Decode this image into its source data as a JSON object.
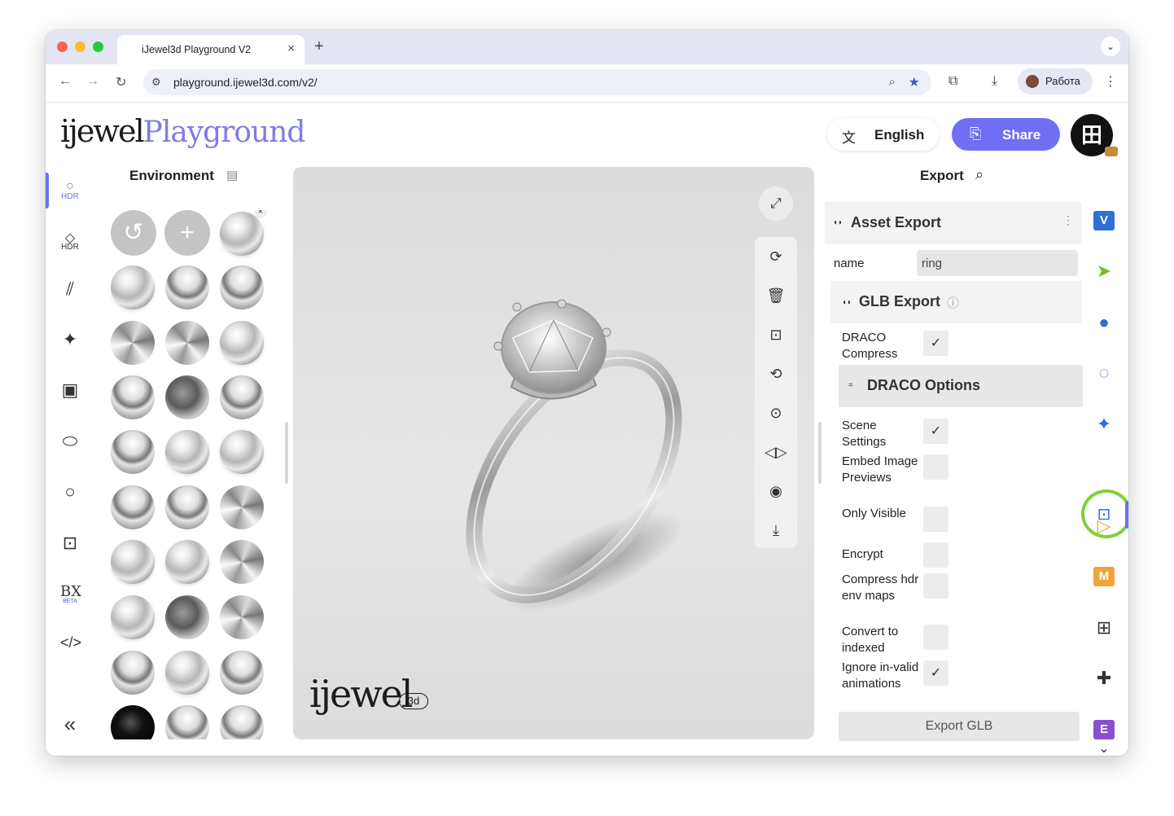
{
  "browser": {
    "tab_title": "iJewel3d Playground V2",
    "tab_close": "×",
    "new_tab": "+",
    "url": "playground.ijewel3d.com/v2/",
    "profile_name": "Работа"
  },
  "header": {
    "logo_brand": "ijewel",
    "logo_product": "Playground",
    "language_label": "English",
    "share_label": "Share"
  },
  "left_rail": {
    "items": [
      {
        "icon": "hdr-environment-icon",
        "sub": "HDR"
      },
      {
        "icon": "hdr-diamond-icon",
        "sub": "HDR"
      },
      {
        "icon": "stripes-icon",
        "sub": ""
      },
      {
        "icon": "sparkles-icon",
        "sub": ""
      },
      {
        "icon": "image-icon",
        "sub": ""
      },
      {
        "icon": "ground-plane-icon",
        "sub": ""
      },
      {
        "icon": "ring-icon",
        "sub": ""
      },
      {
        "icon": "export-box-icon",
        "sub": ""
      },
      {
        "icon": "bx-beta-icon",
        "sub": "BETA",
        "glyph": "BX"
      },
      {
        "icon": "code-icon",
        "sub": ""
      }
    ],
    "collapse_glyph": "«"
  },
  "environment": {
    "title": "Environment",
    "close_glyph": "×"
  },
  "viewport": {
    "logo_text": "ijewel",
    "logo_sub": "3d"
  },
  "export_panel": {
    "title": "Export",
    "asset_export_title": "Asset Export",
    "name_label": "name",
    "name_value": "ring",
    "glb_export_title": "GLB Export",
    "draco_compress_label": "DRACO Compress",
    "draco_compress_checked": true,
    "draco_options_title": "DRACO Options",
    "options": [
      {
        "label": "Scene Settings",
        "checked": true
      },
      {
        "label": "Embed Image Previews",
        "checked": false
      },
      {
        "label": "Only Visible",
        "checked": false
      },
      {
        "label": "Encrypt",
        "checked": false
      },
      {
        "label": "Compress hdr env maps",
        "checked": false
      },
      {
        "label": "Convert to indexed",
        "checked": false
      },
      {
        "label": "Ignore in-valid animations",
        "checked": true
      }
    ],
    "export_button_label": "Export GLB",
    "check_glyph": "✓"
  },
  "right_rail": {
    "badge_v": "V",
    "badge_m": "M",
    "badge_e": "E",
    "colors": {
      "v": "#2f6fd6",
      "m": "#f0a53a",
      "e": "#8a4fd1",
      "highlight_ring": "#7bd33b",
      "accent": "#6e6ff2"
    },
    "collapse_glyph": "⌄"
  }
}
